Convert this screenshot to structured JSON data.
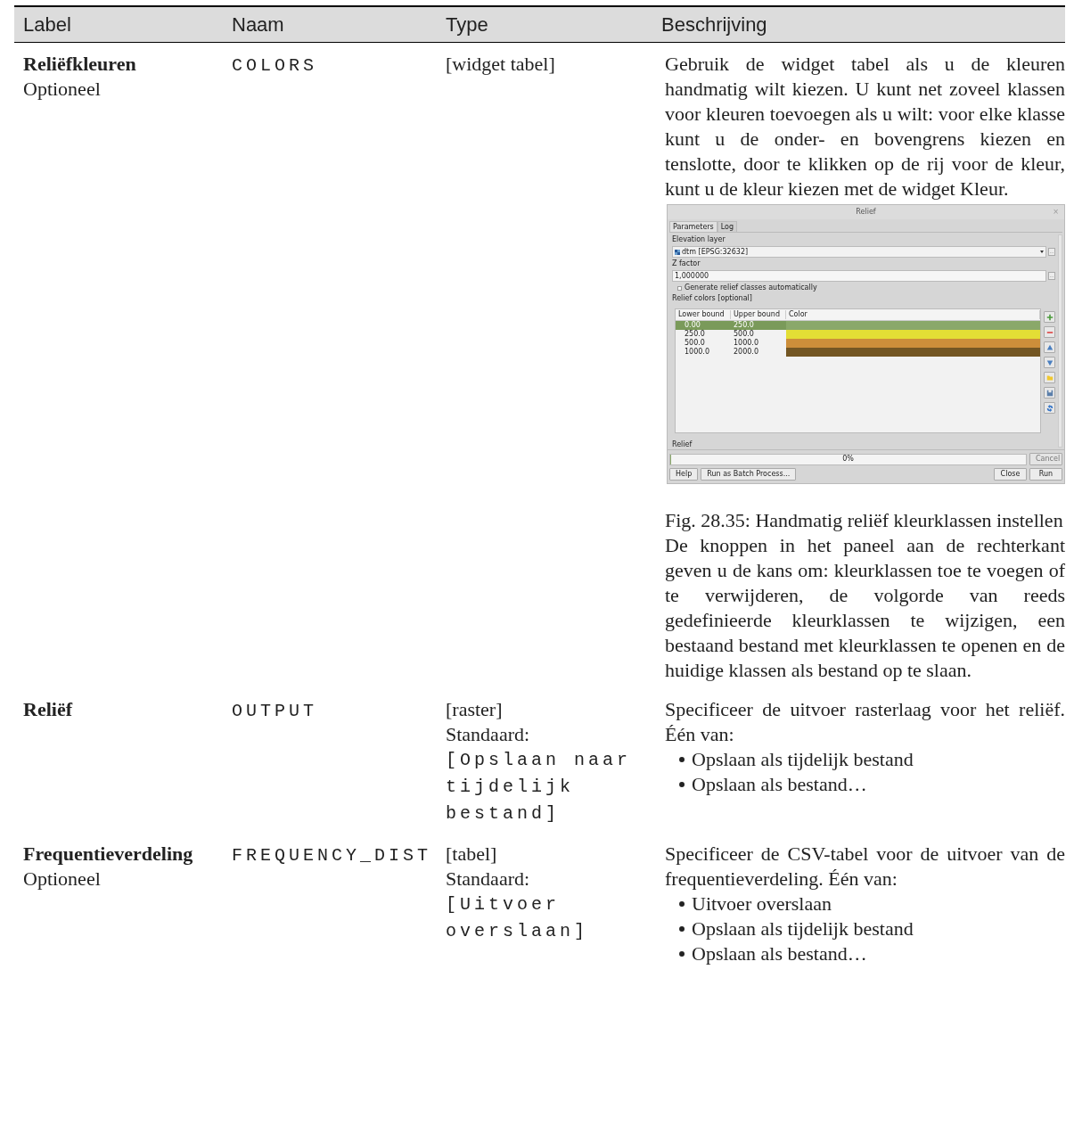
{
  "columns": [
    "Label",
    "Naam",
    "Type",
    "Beschrijving"
  ],
  "rows": [
    {
      "label": "Reliëfkleuren",
      "optional": "Optioneel",
      "name": "COLORS",
      "type": "[widget tabel]",
      "description": "Gebruik de widget tabel als u de kleuren handmatig wilt kiezen. U kunt net zoveel klassen voor kleuren toevoegen als u wilt: voor elke klasse kunt u de onder- en bovengrens kiezen en tenslotte, door te klikken op de rij voor de kleur, kunt u de kleur kiezen met de widget Kleur.",
      "figure": {
        "title": "Relief",
        "close": "×",
        "tabs": [
          {
            "label": "Parameters",
            "selected": true
          },
          {
            "label": "Log",
            "selected": false
          }
        ],
        "elevation_label": "Elevation layer",
        "elevation_value": "dtm [EPSG:32632]",
        "zfactor_label": "Z factor",
        "zfactor_value": "1,000000",
        "browse": "…",
        "checkbox": {
          "label": "Generate relief classes automatically",
          "checked": false
        },
        "colors_label": "Relief colors [optional]",
        "table_columns": [
          "Lower bound",
          "Upper bound",
          "Color"
        ],
        "table_rows": [
          {
            "lower": "0.00",
            "upper": "250.0",
            "color": "#8aa86a",
            "selected": true
          },
          {
            "lower": "250.0",
            "upper": "500.0",
            "color": "#e3de35",
            "selected": false
          },
          {
            "lower": "500.0",
            "upper": "1000.0",
            "color": "#cc8e3a",
            "selected": false
          },
          {
            "lower": "1000.0",
            "upper": "2000.0",
            "color": "#735623",
            "selected": false
          }
        ],
        "output_label": "Relief",
        "progress": {
          "level": 0,
          "reading": "0%"
        },
        "buttons": [
          {
            "label": "Cancel",
            "disabled": true
          },
          {
            "label": "Help",
            "disabled": false
          },
          {
            "label": "Run as Batch Process...",
            "disabled": false
          },
          {
            "label": "Close",
            "disabled": false
          },
          {
            "label": "Run",
            "disabled": false
          }
        ]
      },
      "caption": "Fig. 28.35: Handmatig reliëf kleurklassen instellen",
      "description_2": "De knoppen in het paneel aan de rechterkant geven u de kans om: kleurklassen toe te voegen of te verwijderen, de volgorde van reeds gedefinieerde kleurklassen te wijzigen, een bestaand bestand met kleurklassen te openen en de huidige klassen als bestand op te slaan."
    },
    {
      "label": "Reliëf",
      "name": "OUTPUT",
      "type": "[raster]",
      "default_label": "Standaard:",
      "default_value": "[Opslaan naar tijdelijk bestand]",
      "description": "Specificeer de uitvoer rasterlaag voor het reliëf. Één van:",
      "bullets": [
        "Opslaan als tijdelijk bestand",
        "Opslaan als bestand…"
      ]
    },
    {
      "label": "Frequentieverdeling",
      "optional": "Optioneel",
      "name": "FREQUENCY_DIST",
      "type": "[tabel]",
      "default_label": "Standaard:",
      "default_value": "[Uitvoer overslaan]",
      "description": "Specificeer de CSV-tabel voor de uitvoer van de frequentieverdeling. Één van:",
      "bullets": [
        "Uitvoer overslaan",
        "Opslaan als tijdelijk bestand",
        "Opslaan als bestand…"
      ]
    }
  ]
}
